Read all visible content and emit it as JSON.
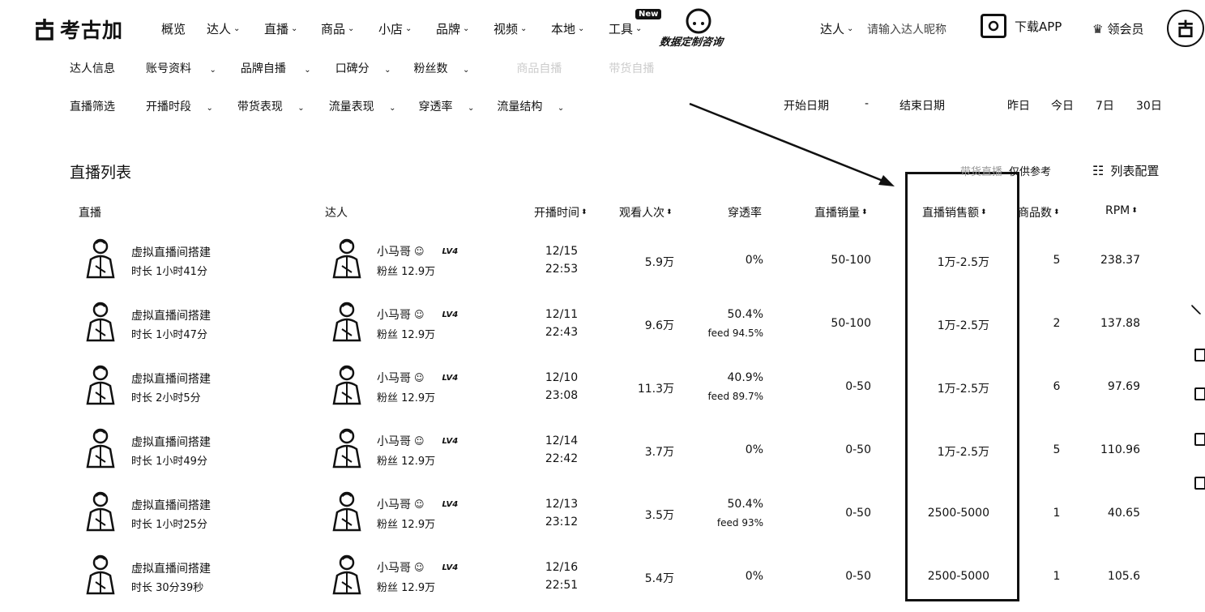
{
  "brand": {
    "name": "考古加"
  },
  "nav": [
    {
      "label": "概览",
      "dropdown": false
    },
    {
      "label": "达人",
      "dropdown": true
    },
    {
      "label": "直播",
      "dropdown": true
    },
    {
      "label": "商品",
      "dropdown": true
    },
    {
      "label": "小店",
      "dropdown": true
    },
    {
      "label": "品牌",
      "dropdown": true
    },
    {
      "label": "视频",
      "dropdown": true
    },
    {
      "label": "本地",
      "dropdown": true
    },
    {
      "label": "工具",
      "dropdown": true
    }
  ],
  "new_badge": "New",
  "promo_text": "数据定制咨询",
  "search": {
    "scope": "达人",
    "placeholder": "请输入达人昵称"
  },
  "download_label": "下载APP",
  "member_label": "领会员",
  "filters_row1": {
    "label": "达人信息",
    "items": [
      "账号资料",
      "品牌自播",
      "口碑分",
      "粉丝数"
    ],
    "faded": [
      "商品自播",
      "带货自播"
    ]
  },
  "filters_row2": {
    "label": "直播筛选",
    "items": [
      "开播时段",
      "带货表现",
      "流量表现",
      "穿透率",
      "流量结构"
    ]
  },
  "date_range": {
    "start_placeholder": "开始日期",
    "separator": "-",
    "end_placeholder": "结束日期",
    "quick": [
      "昨日",
      "今日",
      "7日",
      "30日"
    ]
  },
  "list": {
    "title": "直播列表",
    "ref_note": [
      "带货直播",
      "仅供参考"
    ],
    "config_label": "列表配置",
    "columns": {
      "live": "直播",
      "talent": "达人",
      "start_time": "开播时间",
      "viewers": "观看人次",
      "penetration": "穿透率",
      "sales_volume": "直播销量",
      "sales_amount": "直播销售额",
      "products": "商品数",
      "rpm": "RPM"
    },
    "fans_prefix": "粉丝",
    "rows": [
      {
        "title": "虚拟直播间搭建",
        "duration": "时长 1小时41分",
        "talent": "小马哥",
        "level": "LV4",
        "fans": "12.9万",
        "date": "12/15",
        "time": "22:53",
        "viewers": "5.9万",
        "pen": "0%",
        "feed": "",
        "volume": "50-100",
        "amount": "1万-2.5万",
        "products": "5",
        "rpm": "238.37"
      },
      {
        "title": "虚拟直播间搭建",
        "duration": "时长 1小时47分",
        "talent": "小马哥",
        "level": "LV4",
        "fans": "12.9万",
        "date": "12/11",
        "time": "22:43",
        "viewers": "9.6万",
        "pen": "50.4%",
        "feed": "feed 94.5%",
        "volume": "50-100",
        "amount": "1万-2.5万",
        "products": "2",
        "rpm": "137.88"
      },
      {
        "title": "虚拟直播间搭建",
        "duration": "时长 2小时5分",
        "talent": "小马哥",
        "level": "LV4",
        "fans": "12.9万",
        "date": "12/10",
        "time": "23:08",
        "viewers": "11.3万",
        "pen": "40.9%",
        "feed": "feed 89.7%",
        "volume": "0-50",
        "amount": "1万-2.5万",
        "products": "6",
        "rpm": "97.69"
      },
      {
        "title": "虚拟直播间搭建",
        "duration": "时长 1小时49分",
        "talent": "小马哥",
        "level": "LV4",
        "fans": "12.9万",
        "date": "12/14",
        "time": "22:42",
        "viewers": "3.7万",
        "pen": "0%",
        "feed": "",
        "volume": "0-50",
        "amount": "1万-2.5万",
        "products": "5",
        "rpm": "110.96"
      },
      {
        "title": "虚拟直播间搭建",
        "duration": "时长 1小时25分",
        "talent": "小马哥",
        "level": "LV4",
        "fans": "12.9万",
        "date": "12/13",
        "time": "23:12",
        "viewers": "3.5万",
        "pen": "50.4%",
        "feed": "feed 93%",
        "volume": "0-50",
        "amount": "2500-5000",
        "products": "1",
        "rpm": "40.65"
      },
      {
        "title": "虚拟直播间搭建",
        "duration": "时长 30分39秒",
        "talent": "小马哥",
        "level": "LV4",
        "fans": "12.9万",
        "date": "12/16",
        "time": "22:51",
        "viewers": "5.4万",
        "pen": "0%",
        "feed": "",
        "volume": "0-50",
        "amount": "2500-5000",
        "products": "1",
        "rpm": "105.6"
      }
    ]
  }
}
